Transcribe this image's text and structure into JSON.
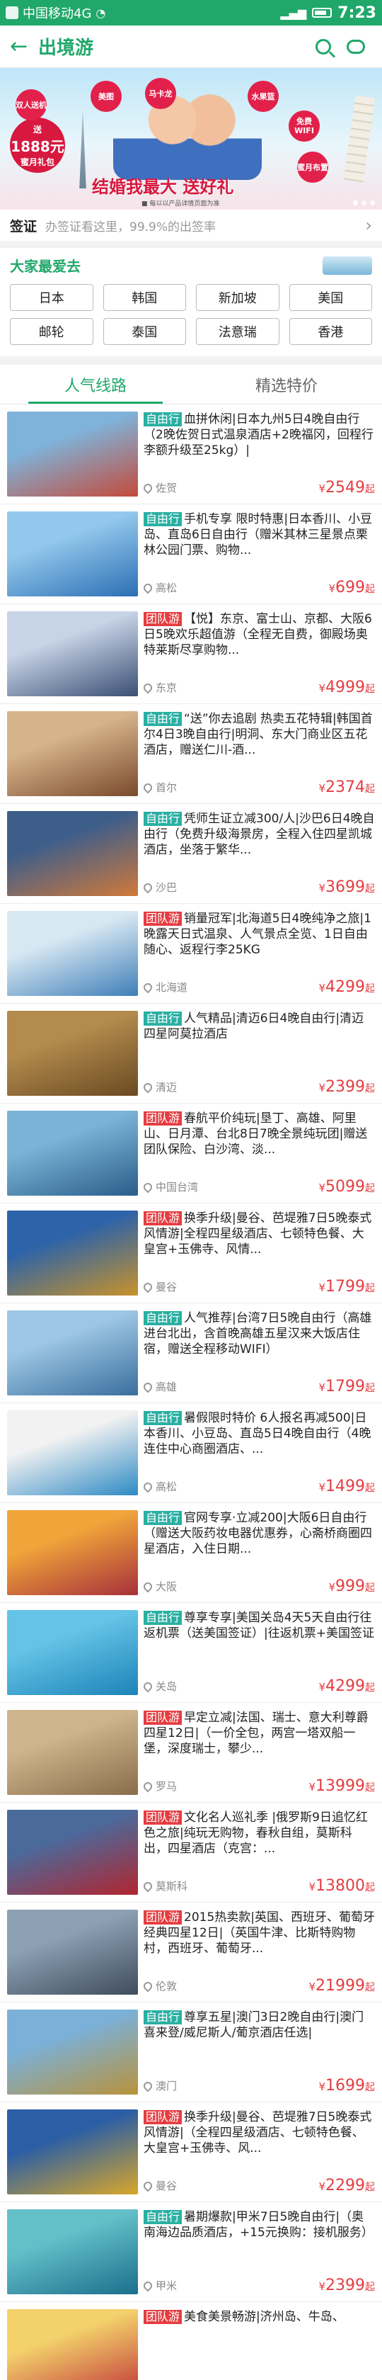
{
  "status": {
    "carrier": "中国移动4G",
    "time": "7:23"
  },
  "header": {
    "back": "←",
    "title": "出境游"
  },
  "banner": {
    "badge_top": "送",
    "badge_amount": "1888元",
    "badge_bottom": "蜜月礼包",
    "bubbles": [
      "双人送机",
      "美图",
      "马卡龙",
      "水果篮",
      "免费WIFI",
      "蜜月布置"
    ],
    "slogan": "结婚我最大 送好礼",
    "fineprint": "■ 每以以产品详情页面为准"
  },
  "visa": {
    "label": "签证",
    "text": "办签证看这里，99.9%的出签率"
  },
  "favorites": {
    "title": "大家最爱去",
    "items": [
      "日本",
      "韩国",
      "新加坡",
      "美国",
      "邮轮",
      "泰国",
      "法意瑞",
      "香港"
    ]
  },
  "tabs": [
    "人气线路",
    "精选特价"
  ],
  "currency": "¥",
  "price_suffix": "起",
  "products": [
    {
      "tag": "自由行",
      "type": "zy",
      "title": "血拼休闲|日本九州5日4晚自由行（2晚佐贺日式温泉酒店+2晚福冈，回程行李额升级至25kg）|",
      "city": "佐贺",
      "price": "2549",
      "colors": [
        "#c44a3a",
        "#7fb3d9"
      ]
    },
    {
      "tag": "自由行",
      "type": "zy",
      "title": "手机专享 限时特惠|日本香川、小豆岛、直岛6日自由行（赠米其林三星景点栗林公园门票、购物...",
      "city": "高松",
      "price": "699",
      "colors": [
        "#2c6fb5",
        "#93c8ec"
      ]
    },
    {
      "tag": "团队游",
      "type": "td",
      "title": "【悦】东京、富士山、京都、大阪6日5晚欢乐超值游（全程无自费，御殿场奥特莱斯尽享购物...",
      "city": "东京",
      "price": "4999",
      "colors": [
        "#3a4f74",
        "#c7d3e6"
      ]
    },
    {
      "tag": "自由行",
      "type": "zy",
      "title": "“送”你去追剧 热卖五花特辑|韩国首尔4日3晚自由行|明洞、东大门商业区五花酒店，赠送仁川-酒...",
      "city": "首尔",
      "price": "2374",
      "colors": [
        "#7a4a2d",
        "#d6b38a"
      ]
    },
    {
      "tag": "自由行",
      "type": "zy",
      "title": "凭师生证立减300/人|沙巴6日4晚自由行（免费升级海景房，全程入住四星凯城酒店，坐落于繁华...",
      "city": "沙巴",
      "price": "3699",
      "colors": [
        "#d1793a",
        "#3e5e8a"
      ]
    },
    {
      "tag": "团队游",
      "type": "td",
      "title": "销量冠军|北海道5日4晚纯净之旅|1晚露天日式温泉、人气景点全览、1日自由随心、返程行李25KG",
      "city": "北海道",
      "price": "4299",
      "colors": [
        "#3f7fb8",
        "#d8e8f3"
      ]
    },
    {
      "tag": "自由行",
      "type": "zy",
      "title": "人气精品|清迈6日4晚自由行|清迈四星阿莫拉酒店",
      "city": "清迈",
      "price": "2399",
      "colors": [
        "#6b4a22",
        "#b38b4d"
      ]
    },
    {
      "tag": "团队游",
      "type": "td",
      "title": "春航平价纯玩|垦丁、高雄、阿里山、日月潭、台北8日7晚全景纯玩团|赠送团队保险、白沙湾、淡...",
      "city": "中国台湾",
      "price": "5099",
      "colors": [
        "#2a5d8a",
        "#7ab3d6"
      ]
    },
    {
      "tag": "团队游",
      "type": "td",
      "title": "换季升级|曼谷、芭堤雅7日5晚泰式风情游|全程四星级酒店、七顿特色餐、大皇宫+玉佛寺、风情...",
      "city": "曼谷",
      "price": "1799",
      "colors": [
        "#c8922a",
        "#2d63a8"
      ]
    },
    {
      "tag": "自由行",
      "type": "zy",
      "title": "人气推荐|台湾7日5晚自由行（高雄进台北出，含首晚高雄五星汉来大饭店住宿，赠送全程移动WIFI）",
      "city": "高雄",
      "price": "1799",
      "colors": [
        "#3a6e9e",
        "#9cc6e3"
      ]
    },
    {
      "tag": "自由行",
      "type": "zy",
      "title": "暑假限时特价 6人报名再减500|日本香川、小豆岛、直岛5日4晚自由行（4晚连住中心商圈酒店、...",
      "city": "高松",
      "price": "1499",
      "colors": [
        "#2e8ac4",
        "#f2f2f2"
      ]
    },
    {
      "tag": "自由行",
      "type": "zy",
      "title": "官网专享·立减200|大阪6日自由行（赠送大阪药妆电器优惠券，心斋桥商圈四星酒店，入住日期...",
      "city": "大阪",
      "price": "999",
      "colors": [
        "#a6303b",
        "#f0a43a"
      ]
    },
    {
      "tag": "自由行",
      "type": "zy",
      "title": "尊享专享|美国关岛4天5天自由行往返机票（送美国签证）|往返机票+美国签证",
      "city": "关岛",
      "price": "4299",
      "colors": [
        "#1d83b8",
        "#64c3e6"
      ]
    },
    {
      "tag": "团队游",
      "type": "td",
      "title": "早定立减|法国、瑞士、意大利尊爵四星12日|（一价全包，两宫一塔双船一堡，深度瑞士，攀少...",
      "city": "罗马",
      "price": "13999",
      "colors": [
        "#8a6d4a",
        "#cdb48c"
      ]
    },
    {
      "tag": "团队游",
      "type": "td",
      "title": "文化名人巡礼季 |俄罗斯9日追忆红色之旅|纯玩无购物，春秋自组，莫斯科出，四星酒店（克宫：...",
      "city": "莫斯科",
      "price": "13800",
      "colors": [
        "#b1252f",
        "#4a6a9c"
      ]
    },
    {
      "tag": "团队游",
      "type": "td",
      "title": "2015热卖款|英国、西班牙、葡萄牙经典四星12日|（英国牛津、比斯特购物村，西班牙、葡萄牙...",
      "city": "伦敦",
      "price": "21999",
      "colors": [
        "#3f4c5c",
        "#8ca0b4"
      ]
    },
    {
      "tag": "自由行",
      "type": "zy",
      "title": "尊享五星|澳门3日2晚自由行|澳门喜来登/威尼斯人/葡京酒店任选|",
      "city": "澳门",
      "price": "1699",
      "colors": [
        "#b8923a",
        "#7bb0d8"
      ]
    },
    {
      "tag": "团队游",
      "type": "td",
      "title": "换季升级|曼谷、芭堤雅7日5晚泰式风情游|（全程四星级酒店、七顿特色餐、大皇宫+玉佛寺、风...",
      "city": "曼谷",
      "price": "2299",
      "colors": [
        "#d9a72a",
        "#2b5ea5"
      ]
    },
    {
      "tag": "自由行",
      "type": "zy",
      "title": "暑期爆款|甲米7日5晚自由行|（奥南海边品质酒店，+15元换购：接机服务）",
      "city": "甲米",
      "price": "2399",
      "colors": [
        "#1b6f8c",
        "#63c0c9"
      ]
    },
    {
      "tag": "团队游",
      "type": "td",
      "title": "美食美景畅游|济州岛、牛岛、",
      "city": "",
      "price": "",
      "colors": [
        "#c23a3a",
        "#f3d16b"
      ]
    }
  ]
}
